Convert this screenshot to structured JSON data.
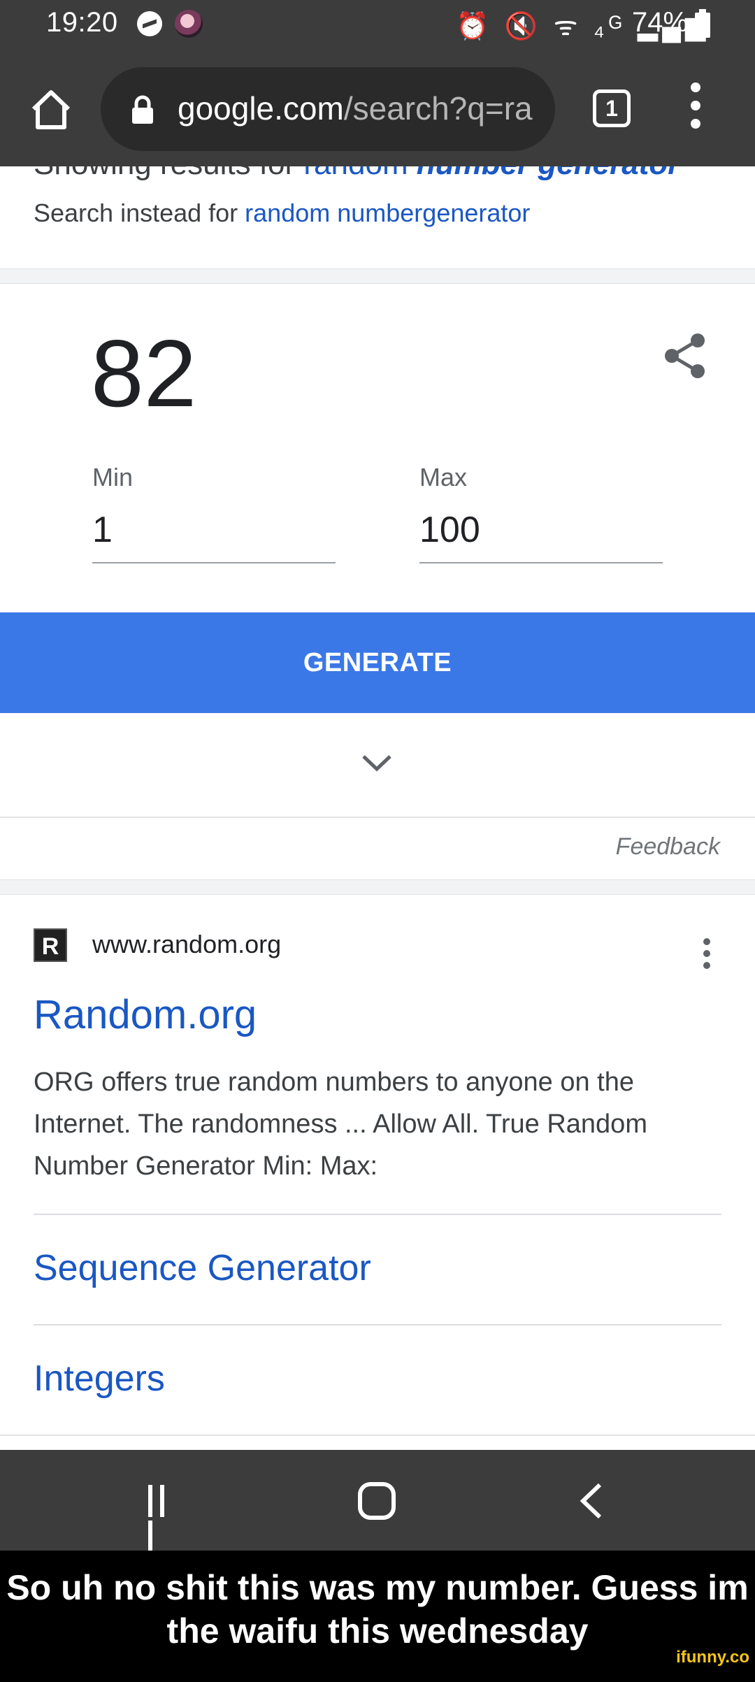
{
  "status_bar": {
    "time": "19:20",
    "icons": "⏰ 🔇 ᯤ ₄ᴳ ▂▄▆",
    "battery": "74%"
  },
  "browser": {
    "url_domain": "google.com",
    "url_path": "/search?q=ra",
    "tab_count": "1"
  },
  "search": {
    "showing_prefix": "Showing results for ",
    "showing_query_plain": "random ",
    "showing_query_bold": "number generator",
    "instead_prefix": "Search instead for ",
    "instead_query": "random numbergenerator"
  },
  "rng_widget": {
    "result": "82",
    "min_label": "Min",
    "min_value": "1",
    "max_label": "Max",
    "max_value": "100",
    "generate_label": "GENERATE",
    "feedback_label": "Feedback"
  },
  "result": {
    "favicon_letter": "R",
    "site_url": "www.random.org",
    "title": "Random.org",
    "snippet": "ORG offers true random numbers to anyone on the Internet. The randomness ... Allow All. True Random Number Generator Min: Max:",
    "sitelinks": [
      "Sequence Generator",
      "Integers"
    ]
  },
  "caption": {
    "line1": "So uh no shit this was my number. Guess im",
    "line2": "the waifu this wednesday",
    "watermark": "ifunny.co"
  },
  "colors": {
    "link": "#1a57c3",
    "generate_button": "#3b78e7",
    "system_bar": "#3c3c3c"
  }
}
